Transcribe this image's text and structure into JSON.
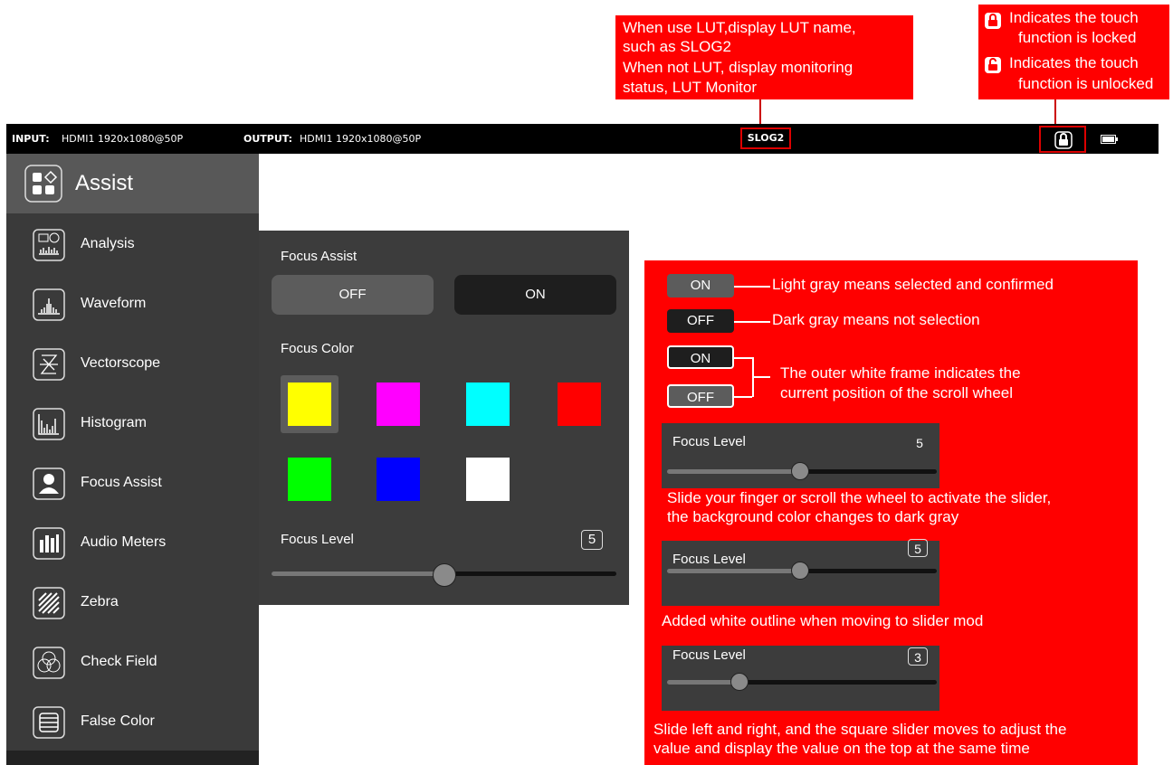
{
  "callouts": {
    "lut": [
      "When use LUT,display LUT name,",
      "such as SLOG2",
      "When not  LUT, display monitoring",
      "status, LUT Monitor"
    ],
    "lock_locked": "Indicates the touch function is locked",
    "lock_unlocked": "Indicates the touch function is unlocked",
    "lock_line1a": "Indicates the touch",
    "lock_line1b": "function is locked",
    "lock_line2a": "Indicates the touch",
    "lock_line2b": "function is unlocked"
  },
  "topbar": {
    "input_label": "INPUT:",
    "input_value": "HDMI1 1920x1080@50P",
    "output_label": "OUTPUT:",
    "output_value": "HDMI1 1920x1080@50P",
    "lut_name": "SLOG2"
  },
  "sidebar": {
    "header": "Assist",
    "items": [
      {
        "label": "Analysis",
        "icon": "analysis-icon"
      },
      {
        "label": "Waveform",
        "icon": "waveform-icon"
      },
      {
        "label": "Vectorscope",
        "icon": "vectorscope-icon"
      },
      {
        "label": "Histogram",
        "icon": "histogram-icon"
      },
      {
        "label": "Focus Assist",
        "icon": "focus-assist-icon"
      },
      {
        "label": "Audio Meters",
        "icon": "audio-meters-icon"
      },
      {
        "label": "Zebra",
        "icon": "zebra-icon"
      },
      {
        "label": "Check Field",
        "icon": "check-field-icon"
      },
      {
        "label": "False Color",
        "icon": "false-color-icon"
      }
    ]
  },
  "panel": {
    "title": "Focus Assist",
    "off_label": "OFF",
    "on_label": "ON",
    "color_title": "Focus Color",
    "colors": [
      "#ffff00",
      "#ff00ff",
      "#00ffff",
      "#ff0000",
      "#00ff00",
      "#0000ff",
      "#ffffff"
    ],
    "selected_color": "#ffff00",
    "level_title": "Focus Level",
    "level_value": "5",
    "level_fraction": 0.5
  },
  "annotations": {
    "on": "ON",
    "off": "OFF",
    "light_gray": "Light gray means selected and confirmed",
    "dark_gray": "Dark gray means not selection",
    "frame_1": "The outer white frame indicates the",
    "frame_2": "current position of the scroll wheel",
    "focus_level": "Focus Level",
    "val5": "5",
    "val3": "3",
    "slide_1": "Slide your finger or scroll the wheel to activate the slider,",
    "slide_2": " the background color changes to dark gray",
    "outline": "Added white outline when moving to slider mod",
    "lr_1": "Slide left and right, and the square slider moves to adjust the",
    "lr_2": "value and  display the value on the top at the same time"
  },
  "colors": {
    "callout_red": "#ff0000",
    "topbar": "#000000",
    "sidebar": "#3a3a3a",
    "sidebar_header": "#585858",
    "panel": "#3c3c3c",
    "toggle_light": "#5c5c5c",
    "toggle_dark": "#1e1e1e"
  }
}
